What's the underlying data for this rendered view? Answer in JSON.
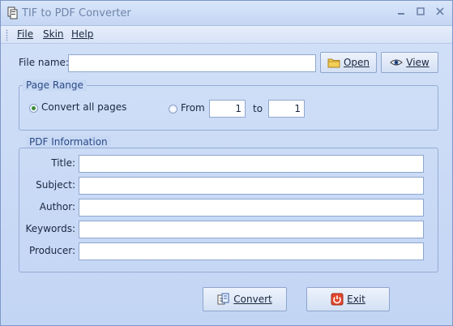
{
  "window": {
    "title": "TIF to PDF Converter"
  },
  "menu": {
    "items": [
      "File",
      "Skin",
      "Help"
    ]
  },
  "file": {
    "label": "File name:",
    "value": "",
    "open_label": "Open",
    "view_label": "View"
  },
  "page_range": {
    "title": "Page Range",
    "convert_all_label": "Convert all pages",
    "from_label": "From",
    "to_label": "to",
    "from_value": "1",
    "to_value": "1",
    "selected": "convert_all"
  },
  "pdf_info": {
    "title": "PDF Information",
    "fields": [
      {
        "label": "Title:",
        "value": ""
      },
      {
        "label": "Subject:",
        "value": ""
      },
      {
        "label": "Author:",
        "value": ""
      },
      {
        "label": "Keywords:",
        "value": ""
      },
      {
        "label": "Producer:",
        "value": ""
      }
    ]
  },
  "actions": {
    "convert_label": "Convert",
    "exit_label": "Exit"
  },
  "colors": {
    "window_bg": "#c7d8f4",
    "group_title": "#2a4a86",
    "exit_icon": "#e2482f"
  }
}
